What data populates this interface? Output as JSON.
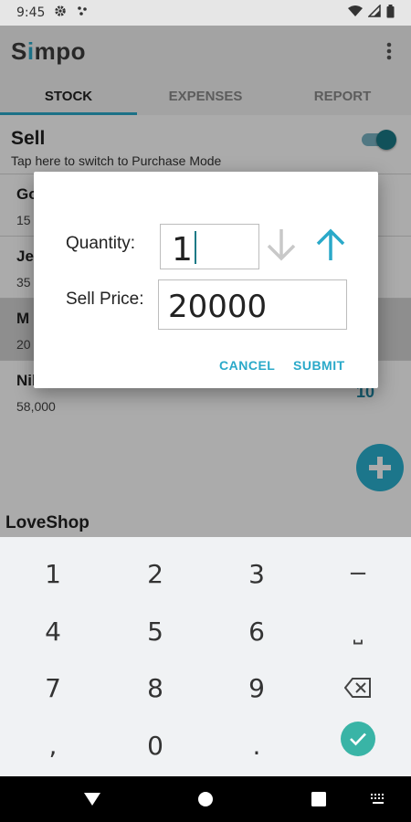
{
  "status_bar": {
    "time": "9:45"
  },
  "app_bar": {
    "title_first": "S",
    "title_accent": "i",
    "title_rest": "mpo"
  },
  "tabs": [
    {
      "label": "STOCK",
      "active": true
    },
    {
      "label": "EXPENSES",
      "active": false
    },
    {
      "label": "REPORT",
      "active": false
    }
  ],
  "mode": {
    "title": "Sell",
    "subtitle": "Tap here to switch to Purchase Mode",
    "toggle_on": true
  },
  "items": [
    {
      "name": "Go",
      "price": "15",
      "qty": ""
    },
    {
      "name": "Je",
      "price": "35",
      "qty": ""
    },
    {
      "name": "M",
      "price": "20",
      "qty": ""
    },
    {
      "name": "Nike",
      "price": "58,000",
      "qty": "10"
    }
  ],
  "shop_name": "LoveShop",
  "dialog": {
    "quantity_label": "Quantity:",
    "quantity_value": "1",
    "price_label": "Sell Price:",
    "price_value": "20000",
    "cancel": "CANCEL",
    "submit": "SUBMIT"
  },
  "keyboard": {
    "row1": [
      "1",
      "2",
      "3",
      "−"
    ],
    "row2": [
      "4",
      "5",
      "6",
      "⎵"
    ],
    "row3": [
      "7",
      "8",
      "9"
    ],
    "row4": [
      ",",
      "0",
      "."
    ]
  },
  "colors": {
    "accent": "#2aa9c9",
    "toggle": "#1a7a86",
    "enter": "#39b4a6"
  }
}
